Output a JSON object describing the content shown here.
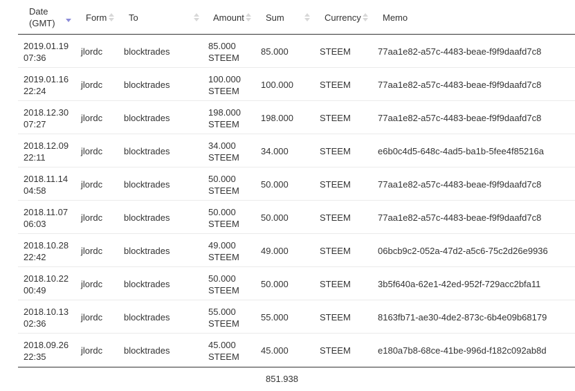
{
  "header": {
    "date": [
      "Date",
      "(GMT)"
    ],
    "from": "Form",
    "to": "To",
    "amount": "Amount",
    "sum": "Sum",
    "currency": "Currency",
    "memo": "Memo"
  },
  "sort": {
    "column": "date",
    "direction": "descending",
    "indicator_color": "#8c8cd8"
  },
  "rows": [
    {
      "date": "2019.01.19",
      "time": "07:36",
      "from": "jlordc",
      "to": "blocktrades",
      "amount": "85.000",
      "amount_unit": "STEEM",
      "sum": "85.000",
      "currency": "STEEM",
      "memo": "77aa1e82-a57c-4483-beae-f9f9daafd7c8"
    },
    {
      "date": "2019.01.16",
      "time": "22:24",
      "from": "jlordc",
      "to": "blocktrades",
      "amount": "100.000",
      "amount_unit": "STEEM",
      "sum": "100.000",
      "currency": "STEEM",
      "memo": "77aa1e82-a57c-4483-beae-f9f9daafd7c8"
    },
    {
      "date": "2018.12.30",
      "time": "07:27",
      "from": "jlordc",
      "to": "blocktrades",
      "amount": "198.000",
      "amount_unit": "STEEM",
      "sum": "198.000",
      "currency": "STEEM",
      "memo": "77aa1e82-a57c-4483-beae-f9f9daafd7c8"
    },
    {
      "date": "2018.12.09",
      "time": "22:11",
      "from": "jlordc",
      "to": "blocktrades",
      "amount": "34.000",
      "amount_unit": "STEEM",
      "sum": "34.000",
      "currency": "STEEM",
      "memo": "e6b0c4d5-648c-4ad5-ba1b-5fee4f85216a"
    },
    {
      "date": "2018.11.14",
      "time": "04:58",
      "from": "jlordc",
      "to": "blocktrades",
      "amount": "50.000",
      "amount_unit": "STEEM",
      "sum": "50.000",
      "currency": "STEEM",
      "memo": "77aa1e82-a57c-4483-beae-f9f9daafd7c8"
    },
    {
      "date": "2018.11.07",
      "time": "06:03",
      "from": "jlordc",
      "to": "blocktrades",
      "amount": "50.000",
      "amount_unit": "STEEM",
      "sum": "50.000",
      "currency": "STEEM",
      "memo": "77aa1e82-a57c-4483-beae-f9f9daafd7c8"
    },
    {
      "date": "2018.10.28",
      "time": "22:42",
      "from": "jlordc",
      "to": "blocktrades",
      "amount": "49.000",
      "amount_unit": "STEEM",
      "sum": "49.000",
      "currency": "STEEM",
      "memo": "06bcb9c2-052a-47d2-a5c6-75c2d26e9936"
    },
    {
      "date": "2018.10.22",
      "time": "00:49",
      "from": "jlordc",
      "to": "blocktrades",
      "amount": "50.000",
      "amount_unit": "STEEM",
      "sum": "50.000",
      "currency": "STEEM",
      "memo": "3b5f640a-62e1-42ed-952f-729acc2bfa11"
    },
    {
      "date": "2018.10.13",
      "time": "02:36",
      "from": "jlordc",
      "to": "blocktrades",
      "amount": "55.000",
      "amount_unit": "STEEM",
      "sum": "55.000",
      "currency": "STEEM",
      "memo": "8163fb71-ae30-4de2-873c-6b4e09b68179"
    },
    {
      "date": "2018.09.26",
      "time": "22:35",
      "from": "jlordc",
      "to": "blocktrades",
      "amount": "45.000",
      "amount_unit": "STEEM",
      "sum": "45.000",
      "currency": "STEEM",
      "memo": "e180a7b8-68ce-41be-996d-f182c092ab8d"
    }
  ],
  "footer": {
    "total_sum": "851.938"
  }
}
